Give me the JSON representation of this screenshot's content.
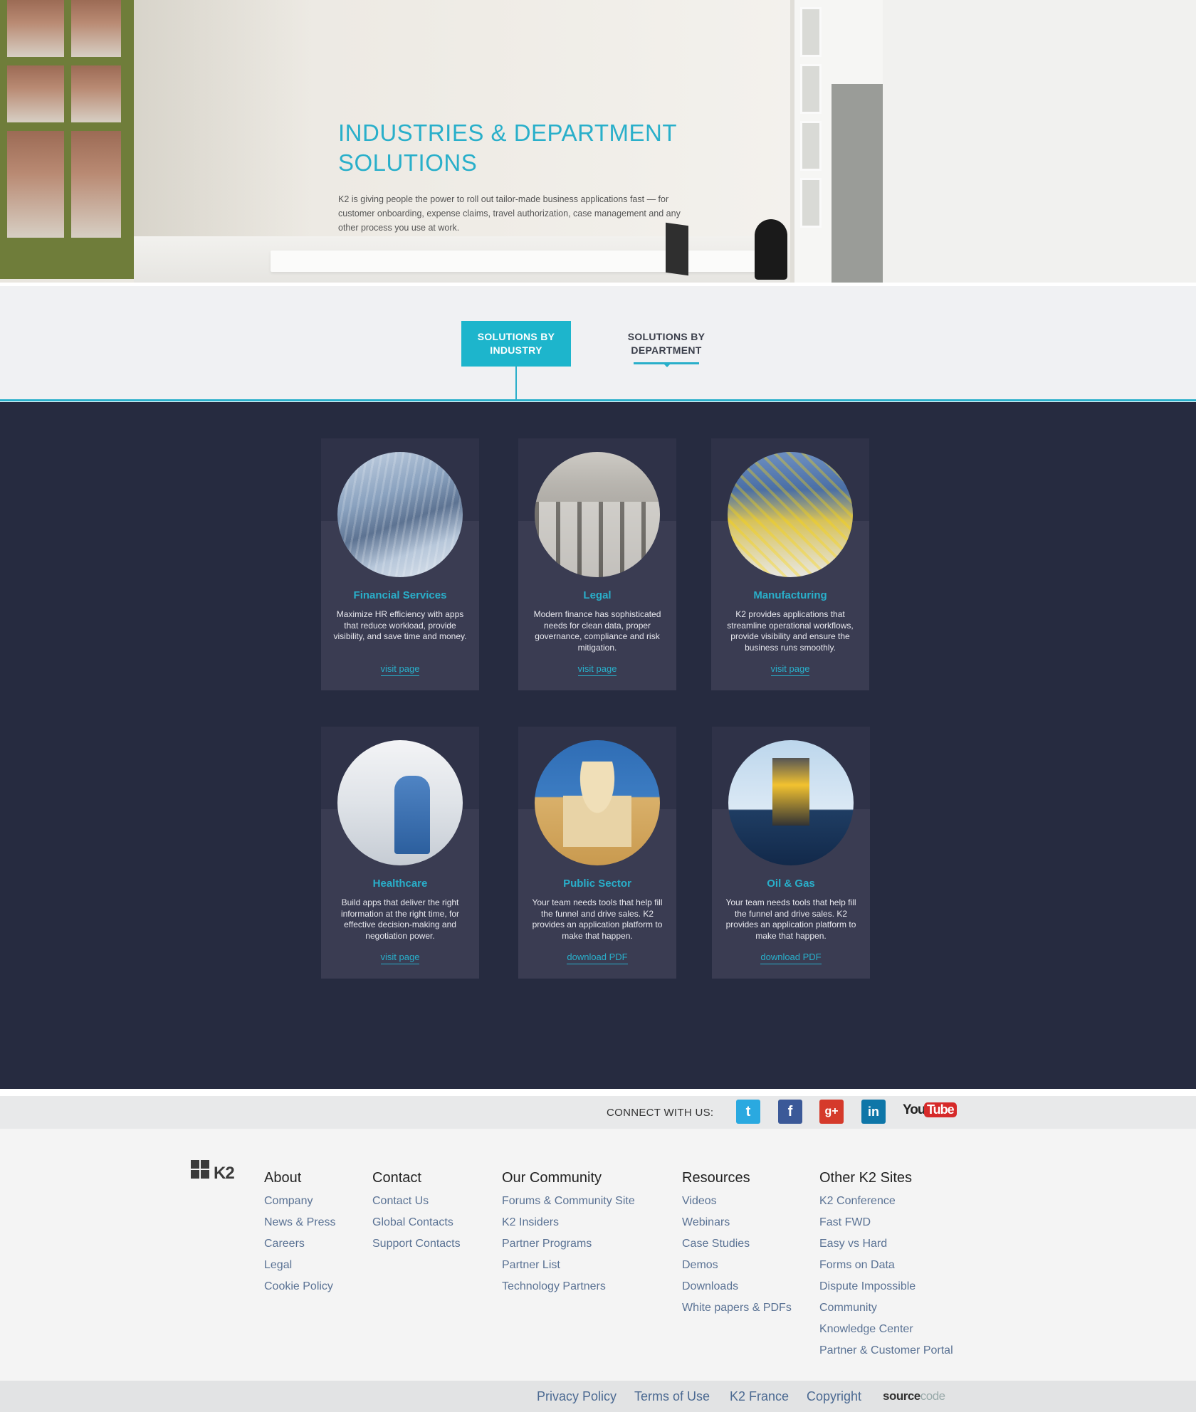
{
  "hero": {
    "title": "INDUSTRIES & DEPARTMENT SOLUTIONS",
    "description": "K2 is giving people the power to roll out tailor-made business applications fast — for customer onboarding, expense claims, travel authorization, case management and any other process you use at work."
  },
  "tabs": {
    "industry": "SOLUTIONS BY INDUSTRY",
    "department": "SOLUTIONS BY DEPARTMENT"
  },
  "cards": [
    {
      "name": "Financial Services",
      "text": "Maximize HR efficiency with apps that reduce workload, provide visibility, and save time and money.",
      "link": "visit page"
    },
    {
      "name": "Legal",
      "text": "Modern finance has sophisticated needs for clean data, proper governance, compliance and risk mitigation.",
      "link": "visit page"
    },
    {
      "name": "Manufacturing",
      "text": "K2 provides applications that streamline operational workflows, provide visibility and ensure the business runs smoothly.",
      "link": "visit page"
    },
    {
      "name": "Healthcare",
      "text": "Build apps that deliver the right information at the right time, for effective decision-making and negotiation power.",
      "link": "visit page"
    },
    {
      "name": "Public Sector",
      "text": "Your team needs tools that help fill the funnel and drive sales. K2 provides an application platform to make that happen.",
      "link": "download PDF"
    },
    {
      "name": "Oil & Gas",
      "text": "Your team needs tools that help fill the funnel and drive sales. K2 provides an application platform to make that happen.",
      "link": "download PDF"
    }
  ],
  "social": {
    "label": "CONNECT WITH US:",
    "twitter": "t",
    "facebook": "f",
    "google": "g+",
    "linkedin": "in",
    "youtube_you": "You",
    "youtube_tube": "Tube"
  },
  "footer": {
    "logo": "K2",
    "columns": [
      {
        "title": "About",
        "items": [
          "Company",
          "News & Press",
          "Careers",
          "Legal",
          "Cookie Policy"
        ]
      },
      {
        "title": "Contact",
        "items": [
          "Contact Us",
          "Global Contacts",
          "Support Contacts"
        ]
      },
      {
        "title": "Our Community",
        "items": [
          "Forums & Community Site",
          "K2 Insiders",
          "Partner Programs",
          "Partner List",
          "Technology Partners"
        ]
      },
      {
        "title": "Resources",
        "items": [
          "Videos",
          "Webinars",
          "Case Studies",
          "Demos",
          "Downloads",
          "White papers & PDFs"
        ]
      },
      {
        "title": "Other K2 Sites",
        "items": [
          "K2 Conference",
          "Fast FWD",
          "Easy vs Hard",
          "Forms on Data",
          "Dispute Impossible",
          "Community",
          "Knowledge Center",
          "Partner & Customer Portal"
        ]
      }
    ],
    "bottom_links": [
      "Privacy Policy",
      "Terms of Use",
      "K2 France",
      "Copyright"
    ],
    "sourcecode_a": "source",
    "sourcecode_b": "code"
  }
}
